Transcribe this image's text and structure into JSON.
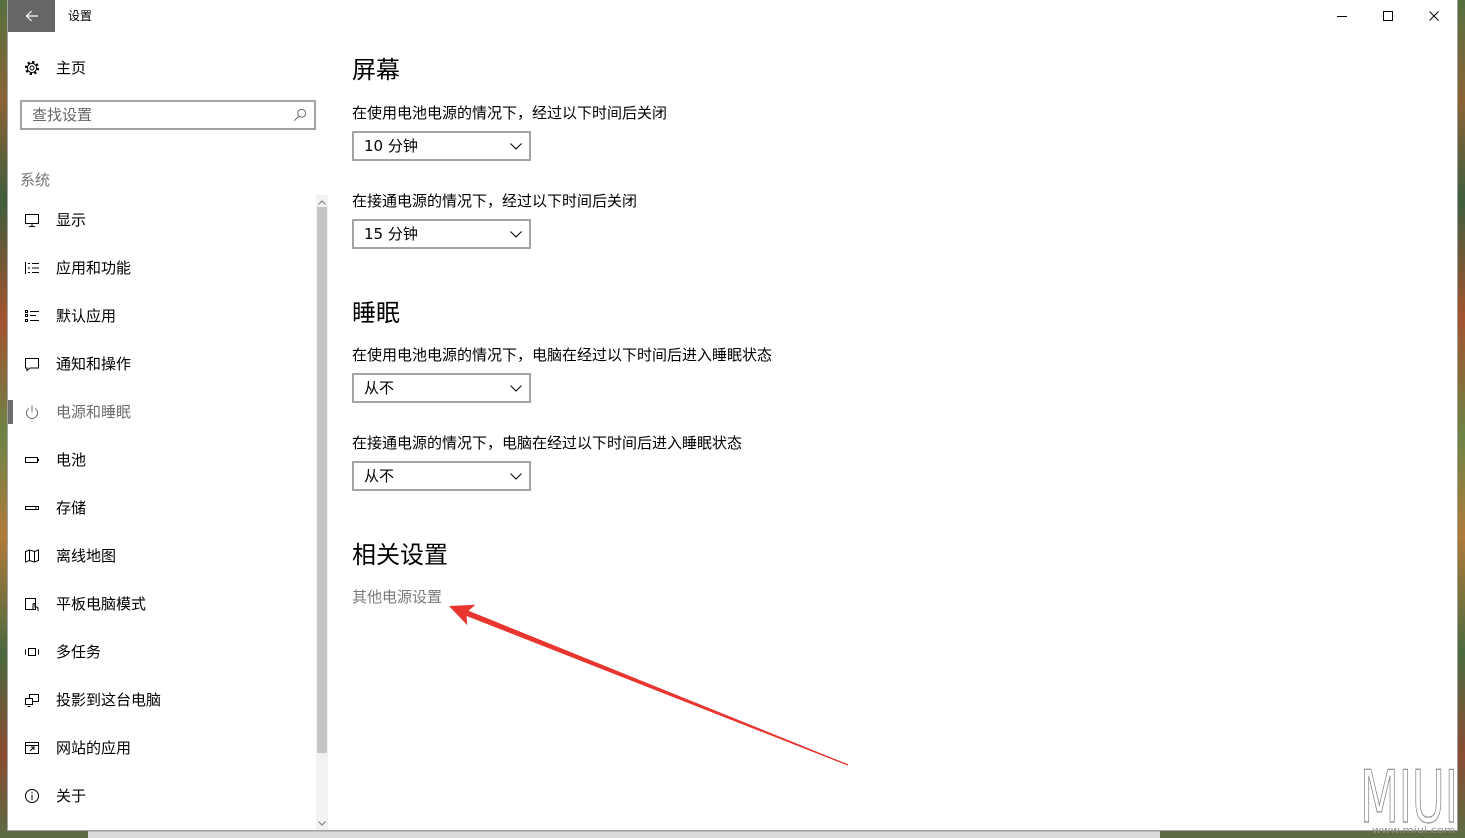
{
  "window": {
    "title": "设置",
    "back_icon": "back-arrow-icon",
    "minimize_icon": "minimize-icon",
    "maximize_icon": "maximize-icon",
    "close_icon": "close-icon"
  },
  "sidebar": {
    "home": {
      "label": "主页",
      "icon": "gear-icon"
    },
    "search": {
      "placeholder": "查找设置",
      "icon": "search-icon"
    },
    "section_label": "系统",
    "items": [
      {
        "label": "显示",
        "icon": "display-icon"
      },
      {
        "label": "应用和功能",
        "icon": "apps-features-icon"
      },
      {
        "label": "默认应用",
        "icon": "default-apps-icon"
      },
      {
        "label": "通知和操作",
        "icon": "notifications-icon"
      },
      {
        "label": "电源和睡眠",
        "icon": "power-icon",
        "selected": true
      },
      {
        "label": "电池",
        "icon": "battery-icon"
      },
      {
        "label": "存储",
        "icon": "storage-icon"
      },
      {
        "label": "离线地图",
        "icon": "offline-maps-icon"
      },
      {
        "label": "平板电脑模式",
        "icon": "tablet-mode-icon"
      },
      {
        "label": "多任务",
        "icon": "multitasking-icon"
      },
      {
        "label": "投影到这台电脑",
        "icon": "project-icon"
      },
      {
        "label": "网站的应用",
        "icon": "web-apps-icon"
      },
      {
        "label": "关于",
        "icon": "info-icon"
      }
    ]
  },
  "main": {
    "dropdown_icon": "chevron-down-icon",
    "screen": {
      "heading": "屏幕",
      "on_battery": {
        "label": "在使用电池电源的情况下，经过以下时间后关闭",
        "value": "10 分钟"
      },
      "plugged_in": {
        "label": "在接通电源的情况下，经过以下时间后关闭",
        "value": "15 分钟"
      }
    },
    "sleep": {
      "heading": "睡眠",
      "on_battery": {
        "label": "在使用电池电源的情况下，电脑在经过以下时间后进入睡眠状态",
        "value": "从不"
      },
      "plugged_in": {
        "label": "在接通电源的情况下，电脑在经过以下时间后进入睡眠状态",
        "value": "从不"
      }
    },
    "related": {
      "heading": "相关设置",
      "link": "其他电源设置"
    }
  },
  "colors": {
    "accent": "#6e6e6e",
    "back_button_bg": "#666666",
    "link": "#7a7a7a",
    "annotation_arrow": "#e8352f"
  },
  "watermark": {
    "logo": "MIUI",
    "url": "www.miui.com"
  }
}
